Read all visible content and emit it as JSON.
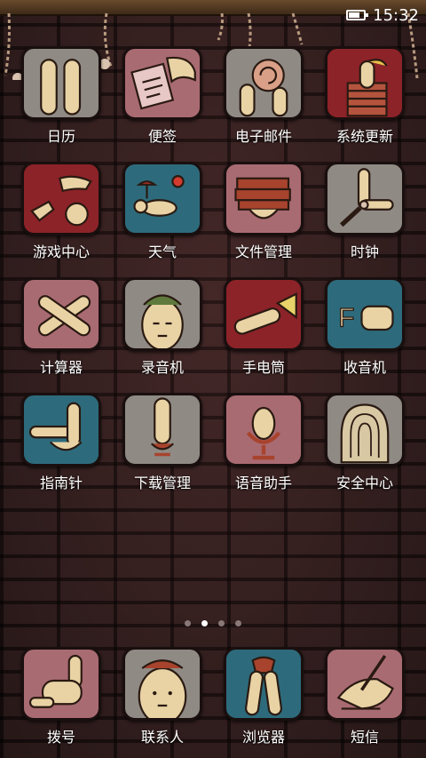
{
  "status_bar": {
    "time": "15:32",
    "battery_level": 0.85
  },
  "home": {
    "apps": [
      {
        "label": "日历",
        "icon": "calendar-fingers-icon",
        "bg": "#8f8a84"
      },
      {
        "label": "便签",
        "icon": "memo-note-icon",
        "bg": "#a96b72"
      },
      {
        "label": "电子邮件",
        "icon": "snail-mail-icon",
        "bg": "#8f8a84"
      },
      {
        "label": "系统更新",
        "icon": "brick-update-icon",
        "bg": "#8c2328"
      },
      {
        "label": "游戏中心",
        "icon": "rock-paper-scissors-icon",
        "bg": "#8c2328"
      },
      {
        "label": "天气",
        "icon": "weather-sun-icon",
        "bg": "#2d6b7c"
      },
      {
        "label": "文件管理",
        "icon": "file-stack-icon",
        "bg": "#a96b72"
      },
      {
        "label": "时钟",
        "icon": "clock-finger-icon",
        "bg": "#8f8a84"
      },
      {
        "label": "计算器",
        "icon": "crossed-fingers-icon",
        "bg": "#a96b72"
      },
      {
        "label": "录音机",
        "icon": "recorder-face-icon",
        "bg": "#8f8a84"
      },
      {
        "label": "手电筒",
        "icon": "flashlight-icon",
        "bg": "#8c2328"
      },
      {
        "label": "收音机",
        "icon": "radio-fm-icon",
        "bg": "#2d6b7c"
      },
      {
        "label": "指南针",
        "icon": "compass-hand-icon",
        "bg": "#2d6b7c"
      },
      {
        "label": "下载管理",
        "icon": "download-finger-icon",
        "bg": "#8f8a84"
      },
      {
        "label": "语音助手",
        "icon": "microphone-icon",
        "bg": "#a96b72"
      },
      {
        "label": "安全中心",
        "icon": "fingerprint-icon",
        "bg": "#8f8a84"
      }
    ]
  },
  "pager": {
    "pages": 4,
    "active": 1
  },
  "dock": {
    "apps": [
      {
        "label": "拨号",
        "icon": "phone-hand-icon",
        "bg": "#a96b72"
      },
      {
        "label": "联系人",
        "icon": "contacts-face-icon",
        "bg": "#8f8a84"
      },
      {
        "label": "浏览器",
        "icon": "browser-legs-icon",
        "bg": "#2d6b7c"
      },
      {
        "label": "短信",
        "icon": "message-pen-icon",
        "bg": "#a96b72"
      }
    ]
  }
}
